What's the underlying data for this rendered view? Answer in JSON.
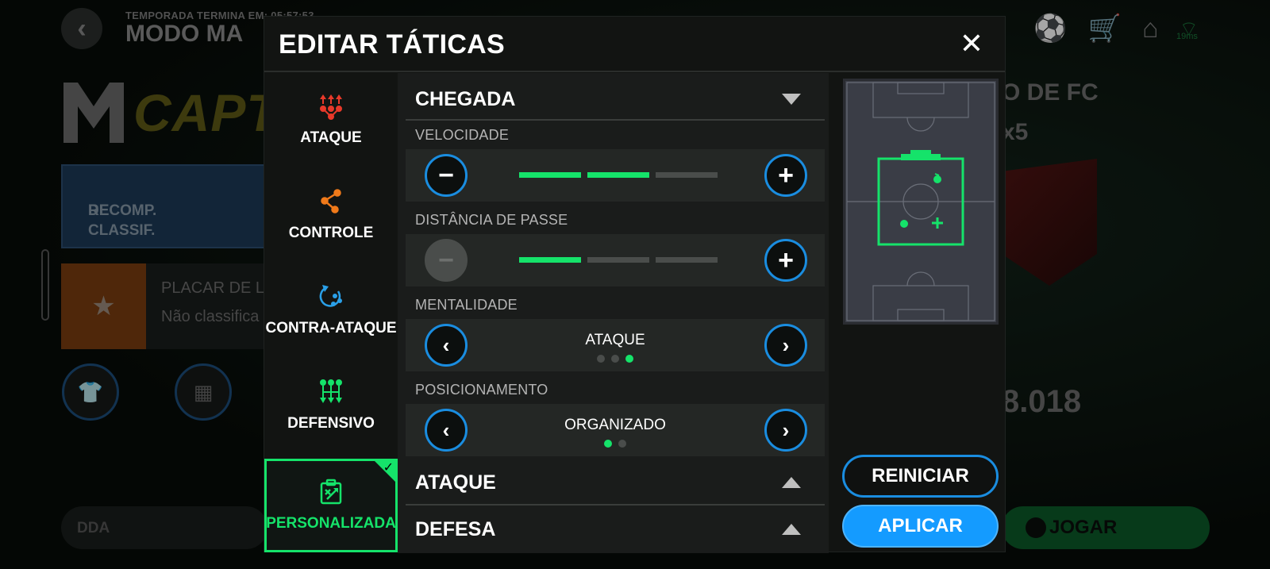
{
  "background": {
    "season_text": "TEMPORADA TERMINA EM: 05:57:53",
    "mode_title": "MODO MA",
    "captain_text": "CAPTA",
    "reward_line1": "RECOMP.",
    "reward_line2": "DE CLASSIF.",
    "board_title": "PLACAR DE L",
    "board_status": "Não classifica",
    "dda_label": "DDA",
    "fc_text": "O DE FC",
    "multiplier": "x5",
    "score": "8.018",
    "play_label": "JOGAR",
    "ping": "19ms"
  },
  "modal": {
    "title": "EDITAR TÁTICAS",
    "close_icon": "close-icon"
  },
  "sidebar": {
    "items": [
      {
        "label": "ATAQUE",
        "icon": "attack-icon",
        "color": "#e8392a"
      },
      {
        "label": "CONTROLE",
        "icon": "control-icon",
        "color": "#f07a1a"
      },
      {
        "label": "CONTRA-ATAQUE",
        "icon": "counter-attack-icon",
        "color": "#2aa0e8"
      },
      {
        "label": "DEFENSIVO",
        "icon": "defensive-icon",
        "color": "#15e36a"
      },
      {
        "label": "PERSONALIZADA",
        "icon": "custom-tactic-icon",
        "color": "#15e36a",
        "active": true
      }
    ]
  },
  "sections": {
    "chegada": {
      "title": "CHEGADA",
      "velocidade": {
        "label": "VELOCIDADE",
        "level": 2,
        "max": 3
      },
      "distancia": {
        "label": "DISTÂNCIA DE PASSE",
        "level": 1,
        "max": 3
      },
      "mentalidade": {
        "label": "MENTALIDADE",
        "value": "ATAQUE",
        "index": 3,
        "count": 3
      },
      "posicionamento": {
        "label": "POSICIONAMENTO",
        "value": "ORGANIZADO",
        "index": 1,
        "count": 2
      }
    },
    "ataque": {
      "title": "ATAQUE"
    },
    "defesa": {
      "title": "DEFESA"
    }
  },
  "buttons": {
    "reset": "REINICIAR",
    "apply": "APLICAR"
  },
  "colors": {
    "accent_green": "#15e36a",
    "accent_blue": "#149bff"
  }
}
